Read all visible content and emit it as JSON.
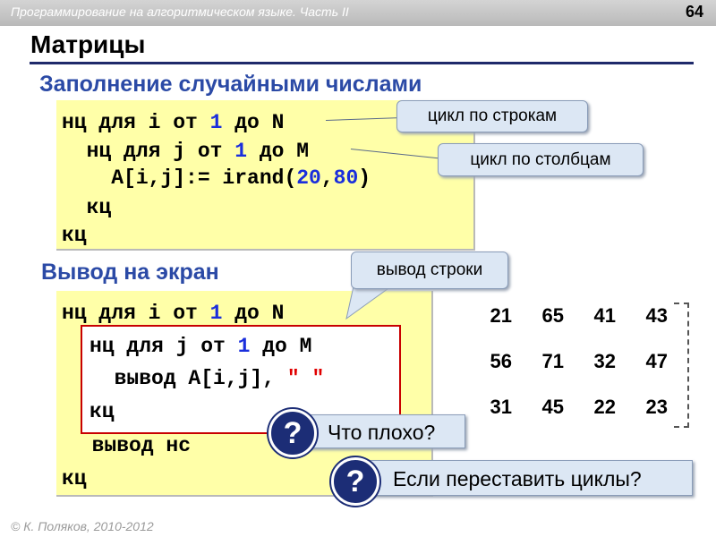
{
  "header": {
    "title": "Программирование на алгоритмическом языке. Часть II",
    "page_number": "64"
  },
  "slide": {
    "title": "Матрицы"
  },
  "section1": {
    "title": "Заполнение случайными числами",
    "code": {
      "l1_kw": "нц для i от ",
      "l1_num": "1",
      "l1_end": " до N",
      "l2_kw": "  нц для j от ",
      "l2_num": "1",
      "l2_end": " до M",
      "l3_a": "    A[i,j]:= irand(",
      "l3_n1": "20",
      "l3_comma": ",",
      "l3_n2": "80",
      "l3_close": ")",
      "l4": "  кц",
      "l5": "кц"
    },
    "callouts": {
      "rows": "цикл по строкам",
      "cols": "цикл по столбцам"
    }
  },
  "section2": {
    "title": "Вывод на экран",
    "code": {
      "l1_kw": "нц для i от ",
      "l1_num": "1",
      "l1_end": " до N",
      "l2_kw": "нц для j от ",
      "l2_num": "1",
      "l2_end": " до M",
      "l3_a": "  вывод A[i,j], ",
      "l3_str": "\" \"",
      "l4": "кц",
      "l5": "  вывод нс",
      "l6": "кц"
    },
    "callout_row": "вывод строки"
  },
  "matrix": [
    [
      "21",
      "65",
      "41",
      "43"
    ],
    [
      "56",
      "71",
      "32",
      "47"
    ],
    [
      "31",
      "45",
      "22",
      "23"
    ]
  ],
  "questions": {
    "mark": "?",
    "q1": "Что плохо?",
    "q2": "Если переставить циклы?"
  },
  "footer": "© К. Поляков, 2010-2012",
  "colors": {
    "section_title": "#2b4aa6",
    "code_bg": "#ffffa8",
    "number": "#1a2edc",
    "string": "#e00000",
    "badge": "#1c2d76",
    "callout_bg": "#dce7f4"
  }
}
